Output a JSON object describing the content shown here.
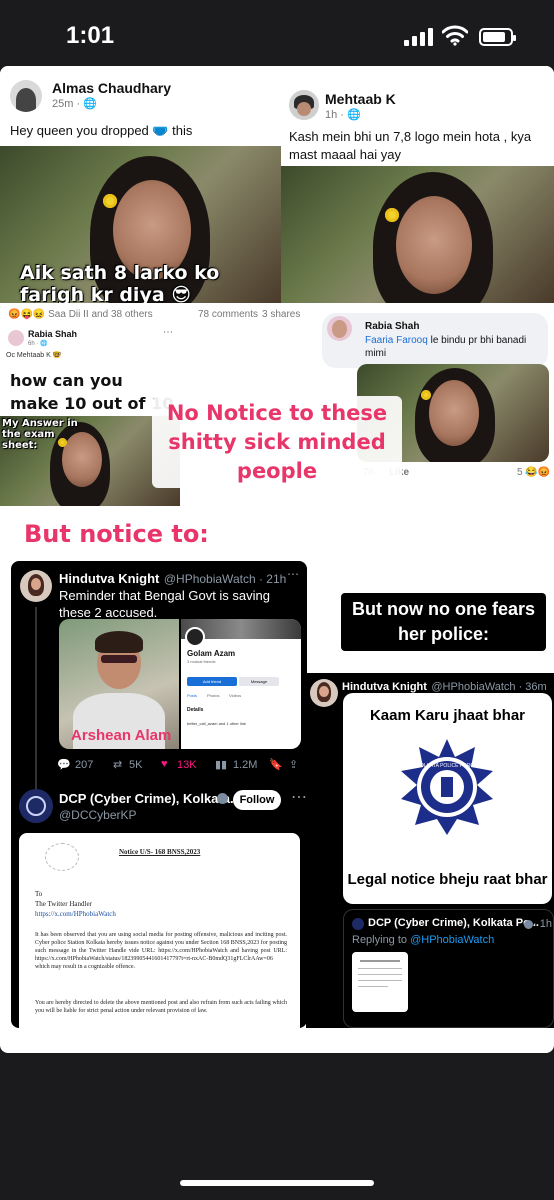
{
  "status_bar": {
    "time": "1:01"
  },
  "post_left": {
    "author": "Almas Chaudhary",
    "time": "25m · ",
    "text": "Hey queen you dropped 🩲 this",
    "caption": "Aik sath 8 larko ko farigh kr diya 😎",
    "reactions": "😡😝😖 Saa Dii II and 38 others",
    "comments": "78 comments",
    "shares": "3 shares"
  },
  "post_right": {
    "author": "Mehtaab K",
    "time": "1h · ",
    "text": "Kash mein bhi un 7,8 logo mein hota , kya mast maaal hai yay"
  },
  "comment_small": {
    "author": "Rabia Shah",
    "time": "6h · 🌐",
    "text": "Oc Mehtaab K 🤓",
    "meme_text": "how can you make 10 out of 10 people happy",
    "meme_caption": "My Answer in the exam sheet:"
  },
  "comment_right": {
    "author": "Rabia Shah",
    "mention": "Faaria Farooq",
    "text": " le bindu pr bhi banadi mimi",
    "time": "7h",
    "like": "Like",
    "reactions": "5 😂😡"
  },
  "overlay": {
    "no_notice": "No Notice to these shitty sick minded people",
    "but_notice": "But notice to:",
    "no_fear": "But now no one fears her police:"
  },
  "tweet_left": {
    "author": "Hindutva Knight",
    "handle": "@HPhobiaWatch · 21h",
    "text": "Reminder that Bengal Govt is saving these 2 accused.",
    "photo_caption": "Arshean Alam",
    "profile_name": "Golam Azam",
    "profile_meta": "3 mutual friends",
    "add_friend": "Add friend",
    "message": "Message",
    "tabs": [
      "Posts",
      "Photos",
      "Videos"
    ],
    "details": "Details",
    "detail_line": "better_call_azam and 1 other link",
    "stats": {
      "replies": "207",
      "reposts": "5K",
      "likes": "13K",
      "views": "1.2M"
    }
  },
  "tweet_dcp": {
    "author": "DCP (Cyber Crime), Kolkata...",
    "handle": "@DCCyberKP",
    "follow": "Follow",
    "notice_title": "Notice U/S- 168 BNSS,2023",
    "notice_to": "To",
    "notice_to_name": "The Twitter Handler",
    "notice_link": "https://x.com/HPhobiaWatch",
    "notice_body": "It has been observed that you are using social media for posting offensive, malicious and inciting post. Cyber police Station Kolkata hereby issues notice against you under Section 168 BNSS,2023 for posting such message in the Twitter Handle vide URL: https://x.com/HPhobiaWatch and having post URL: https://x.com/HPhobiaWatch/status/18239905441601417797t=rt-nxAC-B0mdQ31gFLClrAAw=06 which may result in a cognizable offence.",
    "notice_body2": "You are hereby directed to delete the above mentioned post and also refrain from such acts failing which you will be liable for strict penal action under relevant provision of law."
  },
  "tweet_right": {
    "author": "Hindutva Knight",
    "handle": "@HPhobiaWatch · 36m",
    "meme_top": "Kaam Karu jhaat bhar",
    "badge_text": "KOLKATA POLICE FORCE",
    "meme_bottom": "Legal notice bheju raat bhar",
    "reply_author": "DCP (Cyber Crime), Kolkata Po...",
    "reply_time": "· 1h",
    "replying_to": "Replying to ",
    "replying_handle": "@HPhobiaWatch"
  }
}
